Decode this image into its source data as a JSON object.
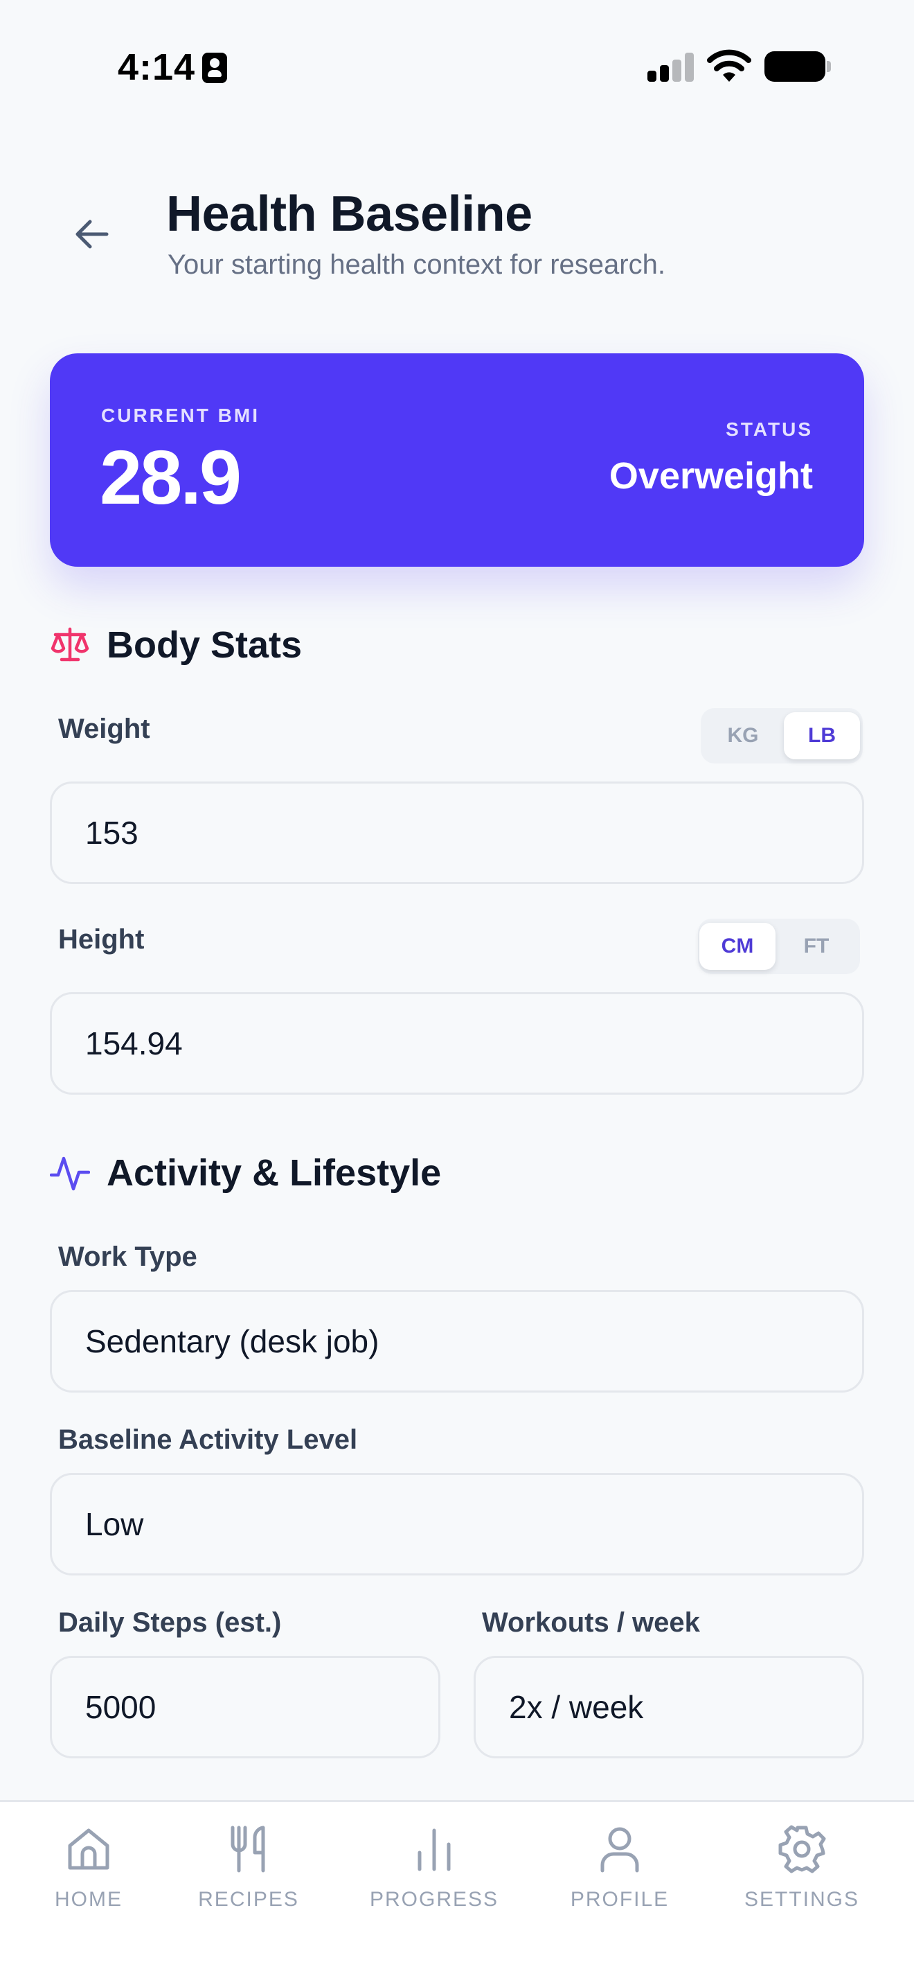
{
  "status_bar": {
    "time": "4:14"
  },
  "header": {
    "title": "Health Baseline",
    "subtitle": "Your starting health context for research."
  },
  "bmi_card": {
    "label": "CURRENT BMI",
    "value": "28.9",
    "status_label": "STATUS",
    "status_value": "Overweight"
  },
  "body_stats": {
    "title": "Body Stats",
    "weight": {
      "label": "Weight",
      "value": "153",
      "units": [
        {
          "label": "KG",
          "active": false
        },
        {
          "label": "LB",
          "active": true
        }
      ]
    },
    "height": {
      "label": "Height",
      "value": "154.94",
      "units": [
        {
          "label": "CM",
          "active": true
        },
        {
          "label": "FT",
          "active": false
        }
      ]
    }
  },
  "activity": {
    "title": "Activity & Lifestyle",
    "work_type": {
      "label": "Work Type",
      "value": "Sedentary (desk job)"
    },
    "activity_level": {
      "label": "Baseline Activity Level",
      "value": "Low"
    },
    "daily_steps": {
      "label": "Daily Steps (est.)",
      "value": "5000"
    },
    "workouts": {
      "label": "Workouts / week",
      "value": "2x / week"
    }
  },
  "tabs": [
    {
      "label": "HOME",
      "icon": "home-icon"
    },
    {
      "label": "RECIPES",
      "icon": "fork-knife-icon"
    },
    {
      "label": "PROGRESS",
      "icon": "bar-chart-icon"
    },
    {
      "label": "PROFILE",
      "icon": "user-icon"
    },
    {
      "label": "SETTINGS",
      "icon": "gear-icon"
    }
  ],
  "colors": {
    "accent": "#5039f6",
    "scale_icon": "#f0346c",
    "activity_icon": "#5b4cf0",
    "tab_inactive": "#98a2b3"
  }
}
